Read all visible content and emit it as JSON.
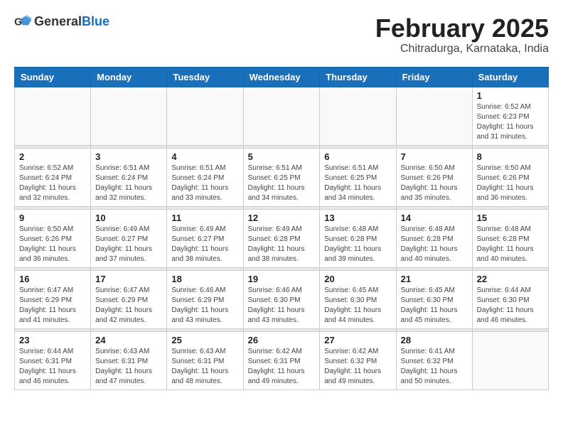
{
  "header": {
    "logo_general": "General",
    "logo_blue": "Blue",
    "title": "February 2025",
    "subtitle": "Chitradurga, Karnataka, India"
  },
  "weekdays": [
    "Sunday",
    "Monday",
    "Tuesday",
    "Wednesday",
    "Thursday",
    "Friday",
    "Saturday"
  ],
  "weeks": [
    [
      {
        "day": "",
        "info": ""
      },
      {
        "day": "",
        "info": ""
      },
      {
        "day": "",
        "info": ""
      },
      {
        "day": "",
        "info": ""
      },
      {
        "day": "",
        "info": ""
      },
      {
        "day": "",
        "info": ""
      },
      {
        "day": "1",
        "info": "Sunrise: 6:52 AM\nSunset: 6:23 PM\nDaylight: 11 hours\nand 31 minutes."
      }
    ],
    [
      {
        "day": "2",
        "info": "Sunrise: 6:52 AM\nSunset: 6:24 PM\nDaylight: 11 hours\nand 32 minutes."
      },
      {
        "day": "3",
        "info": "Sunrise: 6:51 AM\nSunset: 6:24 PM\nDaylight: 11 hours\nand 32 minutes."
      },
      {
        "day": "4",
        "info": "Sunrise: 6:51 AM\nSunset: 6:24 PM\nDaylight: 11 hours\nand 33 minutes."
      },
      {
        "day": "5",
        "info": "Sunrise: 6:51 AM\nSunset: 6:25 PM\nDaylight: 11 hours\nand 34 minutes."
      },
      {
        "day": "6",
        "info": "Sunrise: 6:51 AM\nSunset: 6:25 PM\nDaylight: 11 hours\nand 34 minutes."
      },
      {
        "day": "7",
        "info": "Sunrise: 6:50 AM\nSunset: 6:26 PM\nDaylight: 11 hours\nand 35 minutes."
      },
      {
        "day": "8",
        "info": "Sunrise: 6:50 AM\nSunset: 6:26 PM\nDaylight: 11 hours\nand 36 minutes."
      }
    ],
    [
      {
        "day": "9",
        "info": "Sunrise: 6:50 AM\nSunset: 6:26 PM\nDaylight: 11 hours\nand 36 minutes."
      },
      {
        "day": "10",
        "info": "Sunrise: 6:49 AM\nSunset: 6:27 PM\nDaylight: 11 hours\nand 37 minutes."
      },
      {
        "day": "11",
        "info": "Sunrise: 6:49 AM\nSunset: 6:27 PM\nDaylight: 11 hours\nand 38 minutes."
      },
      {
        "day": "12",
        "info": "Sunrise: 6:49 AM\nSunset: 6:28 PM\nDaylight: 11 hours\nand 38 minutes."
      },
      {
        "day": "13",
        "info": "Sunrise: 6:48 AM\nSunset: 6:28 PM\nDaylight: 11 hours\nand 39 minutes."
      },
      {
        "day": "14",
        "info": "Sunrise: 6:48 AM\nSunset: 6:28 PM\nDaylight: 11 hours\nand 40 minutes."
      },
      {
        "day": "15",
        "info": "Sunrise: 6:48 AM\nSunset: 6:28 PM\nDaylight: 11 hours\nand 40 minutes."
      }
    ],
    [
      {
        "day": "16",
        "info": "Sunrise: 6:47 AM\nSunset: 6:29 PM\nDaylight: 11 hours\nand 41 minutes."
      },
      {
        "day": "17",
        "info": "Sunrise: 6:47 AM\nSunset: 6:29 PM\nDaylight: 11 hours\nand 42 minutes."
      },
      {
        "day": "18",
        "info": "Sunrise: 6:46 AM\nSunset: 6:29 PM\nDaylight: 11 hours\nand 43 minutes."
      },
      {
        "day": "19",
        "info": "Sunrise: 6:46 AM\nSunset: 6:30 PM\nDaylight: 11 hours\nand 43 minutes."
      },
      {
        "day": "20",
        "info": "Sunrise: 6:45 AM\nSunset: 6:30 PM\nDaylight: 11 hours\nand 44 minutes."
      },
      {
        "day": "21",
        "info": "Sunrise: 6:45 AM\nSunset: 6:30 PM\nDaylight: 11 hours\nand 45 minutes."
      },
      {
        "day": "22",
        "info": "Sunrise: 6:44 AM\nSunset: 6:30 PM\nDaylight: 11 hours\nand 46 minutes."
      }
    ],
    [
      {
        "day": "23",
        "info": "Sunrise: 6:44 AM\nSunset: 6:31 PM\nDaylight: 11 hours\nand 46 minutes."
      },
      {
        "day": "24",
        "info": "Sunrise: 6:43 AM\nSunset: 6:31 PM\nDaylight: 11 hours\nand 47 minutes."
      },
      {
        "day": "25",
        "info": "Sunrise: 6:43 AM\nSunset: 6:31 PM\nDaylight: 11 hours\nand 48 minutes."
      },
      {
        "day": "26",
        "info": "Sunrise: 6:42 AM\nSunset: 6:31 PM\nDaylight: 11 hours\nand 49 minutes."
      },
      {
        "day": "27",
        "info": "Sunrise: 6:42 AM\nSunset: 6:32 PM\nDaylight: 11 hours\nand 49 minutes."
      },
      {
        "day": "28",
        "info": "Sunrise: 6:41 AM\nSunset: 6:32 PM\nDaylight: 11 hours\nand 50 minutes."
      },
      {
        "day": "",
        "info": ""
      }
    ]
  ]
}
